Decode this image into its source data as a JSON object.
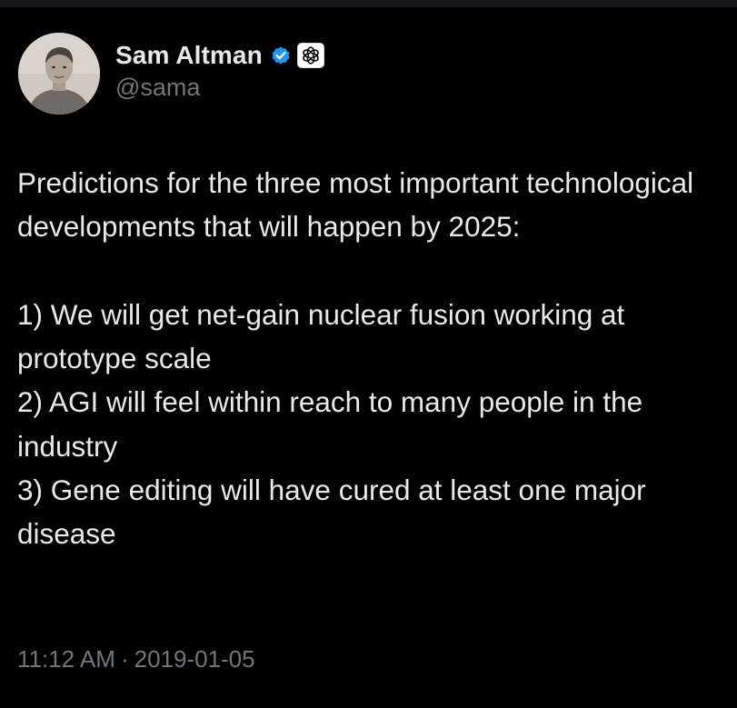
{
  "author": {
    "name": "Sam Altman",
    "handle": "@sama",
    "verified_icon": "verified-badge-icon",
    "affiliate_icon": "openai-logo-icon",
    "verified_color": "#1d9bf0"
  },
  "tweet": {
    "intro": "Predictions for the three most important technological developments that will happen by 2025:",
    "items": [
      "1) We will get net-gain nuclear fusion working at prototype scale",
      "2) AGI will feel within reach to many people in the industry",
      "3) Gene editing will have cured at least one major disease"
    ]
  },
  "meta": {
    "time": "11:12 AM",
    "separator": "·",
    "date": "2019-01-05"
  },
  "colors": {
    "background": "#000000",
    "text": "#e7e9ea",
    "secondary_text": "#71767b"
  }
}
